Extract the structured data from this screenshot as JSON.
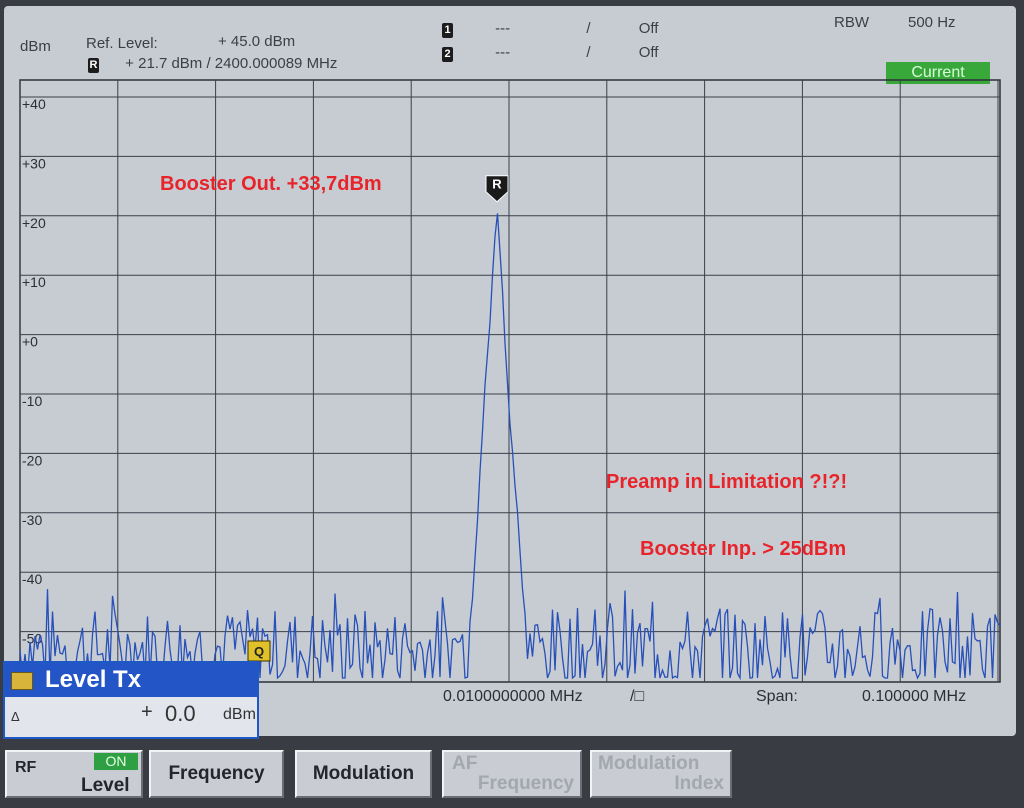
{
  "header": {
    "unit": "dBm",
    "ref_level_label": "Ref. Level:",
    "ref_level_value": "+ 45.0  dBm",
    "marker_r_label": "R",
    "marker_r_value": "+ 21.7  dBm  /  2400.000089   MHz",
    "m1_label": "1",
    "m1_value": "---",
    "m1_sep": "/",
    "m1_state": "Off",
    "m2_label": "2",
    "m2_value": "---",
    "m2_sep": "/",
    "m2_state": "Off",
    "rbw_label": "RBW",
    "rbw_value": "500 Hz",
    "current_label": "Current"
  },
  "chart_data": {
    "type": "line",
    "title": "",
    "y_ticks": [
      "+40",
      "+30",
      "+20",
      "+10",
      "+0",
      "-10",
      "-20",
      "-30",
      "-40",
      "-50"
    ],
    "ylim": [
      -60,
      45
    ],
    "x_span_mhz": 0.1,
    "x_center_offset_mhz": 0.01,
    "grid": true,
    "series": [
      {
        "color": "#2750b8",
        "peak_dbm": 21.7,
        "noise_floor_dbm": -53
      }
    ],
    "annotations": [
      "Booster Out. +33,7dBm",
      "Preamp in Limitation ?!?!",
      "Booster Inp. > 25dBm"
    ],
    "peak_marker": "R",
    "low_marker": "Q"
  },
  "footer": {
    "offset_value": "0.0100000000 MHz",
    "offset_suffix": "/□",
    "span_label": "Span:",
    "span_value": "0.100000  MHz"
  },
  "level_panel": {
    "title": "Level Tx",
    "delta_symbol": "Δ",
    "sign": "+",
    "value": "0.0",
    "unit": "dBm"
  },
  "softkeys": {
    "rf_label": "RF",
    "rf_state": "ON",
    "rf_sub": "Level",
    "frequency": "Frequency",
    "modulation": "Modulation",
    "af_frequency_top": "AF",
    "af_frequency_bottom": "Frequency",
    "mod_index_top": "Modulation",
    "mod_index_bottom": "Index"
  }
}
